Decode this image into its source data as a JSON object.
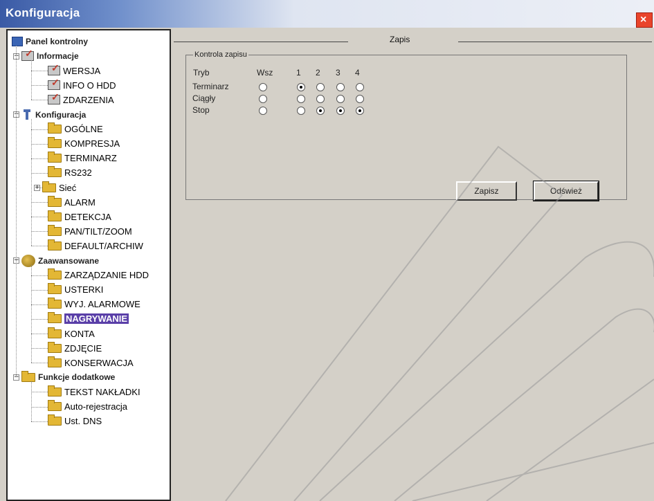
{
  "window": {
    "title": "Konfiguracja",
    "close_label": "×"
  },
  "tree": {
    "root": "Panel kontrolny",
    "informacje": {
      "label": "Informacje",
      "items": [
        "WERSJA",
        "INFO O HDD",
        "ZDARZENIA"
      ]
    },
    "konfiguracja": {
      "label": "Konfiguracja",
      "items": [
        "OGÓLNE",
        "KOMPRESJA",
        "TERMINARZ",
        "RS232",
        "Sieć",
        "ALARM",
        "DETEKCJA",
        "PAN/TILT/ZOOM",
        "DEFAULT/ARCHIW"
      ]
    },
    "zaawansowane": {
      "label": "Zaawansowane",
      "items": [
        "ZARZĄDZANIE HDD",
        "USTERKI",
        "WYJ. ALARMOWE",
        "NAGRYWANIE",
        "KONTA",
        "ZDJĘCIE",
        "KONSERWACJA"
      ]
    },
    "funkcje": {
      "label": "Funkcje dodatkowe",
      "items": [
        "TEKST NAKŁADKI",
        "Auto-rejestracja",
        "Ust. DNS"
      ]
    },
    "selected": "NAGRYWANIE"
  },
  "main": {
    "header": "Zapis",
    "group_title": "Kontrola zapisu",
    "columns": [
      "Tryb",
      "Wsz",
      "1",
      "2",
      "3",
      "4"
    ],
    "rows": [
      {
        "label": "Terminarz",
        "states": [
          false,
          true,
          false,
          false,
          false
        ]
      },
      {
        "label": "Ciągły",
        "states": [
          false,
          false,
          false,
          false,
          false
        ]
      },
      {
        "label": "Stop",
        "states": [
          false,
          false,
          true,
          true,
          true
        ]
      }
    ],
    "buttons": {
      "save": "Zapisz",
      "refresh": "Odśwież"
    }
  }
}
